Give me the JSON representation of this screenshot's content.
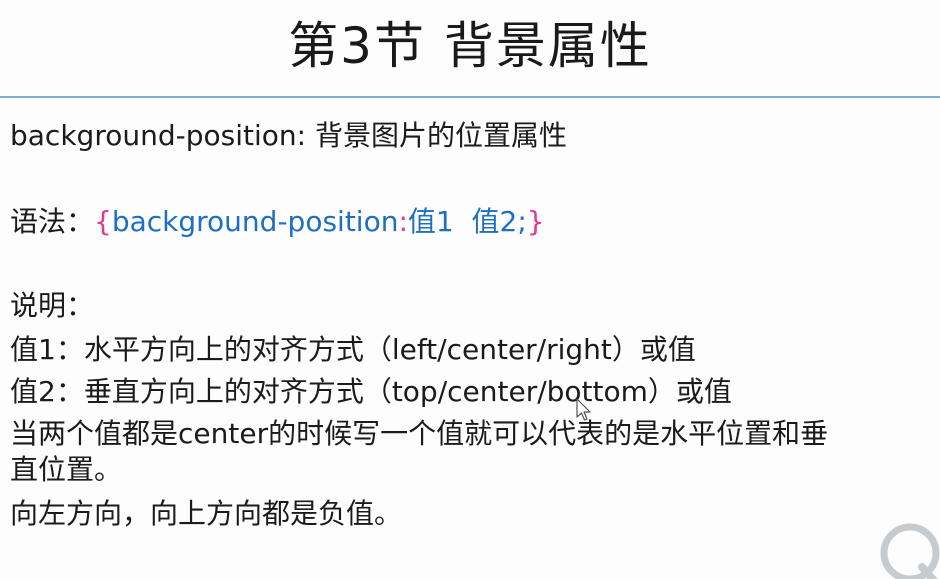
{
  "slide": {
    "title": "第3节 背景属性",
    "subtitle_line": "background-position: 背景图片的位置属性",
    "syntax": {
      "label": "语法：",
      "open_brace": "{",
      "property": "background-position",
      "colon": ":",
      "values": "值1  值2;",
      "close_brace": "}"
    },
    "explain_label": "说明：",
    "value1": "值1：水平方向上的对齐方式（left/center/right）或值",
    "value2": "值2：垂直方向上的对齐方式（top/center/bottom）或值",
    "note_line1": "当两个值都是center的时候写一个值就可以代表的是水平位置和垂",
    "note_line2": "直位置。",
    "note_line3": "向左方向，向上方向都是负值。"
  },
  "colors": {
    "title_rule": "#7aaedc",
    "syntax_brace": "#e03c8a",
    "syntax_property": "#1f6fc0"
  }
}
